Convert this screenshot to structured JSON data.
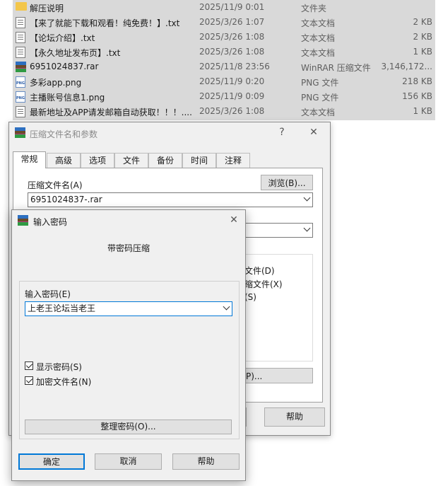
{
  "files": [
    {
      "icon": "folder-icon",
      "name": "解压说明",
      "date": "2025/11/9 0:01",
      "type": "文件夹",
      "size": ""
    },
    {
      "icon": "txt-file-icon",
      "name": "【来了就能下载和观看！纯免费！】.txt",
      "date": "2025/3/26 1:07",
      "type": "文本文档",
      "size": "2 KB"
    },
    {
      "icon": "txt-file-icon",
      "name": "【论坛介绍】.txt",
      "date": "2025/3/26 1:08",
      "type": "文本文档",
      "size": "2 KB"
    },
    {
      "icon": "txt-file-icon",
      "name": "【永久地址发布页】.txt",
      "date": "2025/3/26 1:08",
      "type": "文本文档",
      "size": "1 KB"
    },
    {
      "icon": "rar-file-icon",
      "name": "6951024837.rar",
      "date": "2025/11/8 23:56",
      "type": "WinRAR 压缩文件",
      "size": "3,146,172..."
    },
    {
      "icon": "png-file-icon",
      "name": "多彩app.png",
      "date": "2025/11/9 0:20",
      "type": "PNG 文件",
      "size": "218 KB"
    },
    {
      "icon": "png-file-icon",
      "name": "主播账号信息1.png",
      "date": "2025/11/9 0:09",
      "type": "PNG 文件",
      "size": "156 KB"
    },
    {
      "icon": "txt-file-icon",
      "name": "最新地址及APP请发邮箱自动获取！！！....",
      "date": "2025/3/26 1:08",
      "type": "文本文档",
      "size": "1 KB"
    }
  ],
  "archive_dialog": {
    "title": "压缩文件名和参数",
    "help_glyph": "?",
    "close_glyph": "✕",
    "tabs": [
      "常规",
      "高级",
      "选项",
      "文件",
      "备份",
      "时间",
      "注释"
    ],
    "archive_name_label": "压缩文件名(A)",
    "browse_button": "浏览(B)...",
    "archive_name_value": "6951024837-.rar",
    "partial_options": [
      "文件(D)",
      "缩文件(X)",
      "(S)"
    ],
    "partial_button": "P)...",
    "help_button": "帮助"
  },
  "password_dialog": {
    "title": "输入密码",
    "close_glyph": "✕",
    "heading": "带密码压缩",
    "enter_password_label": "输入密码(E)",
    "password_value": "上老王论坛当老王",
    "show_password_label": "显示密码(S)",
    "show_password_checked": true,
    "encrypt_names_label": "加密文件名(N)",
    "encrypt_names_checked": true,
    "organize_button": "整理密码(O)...",
    "ok_button": "确定",
    "cancel_button": "取消",
    "help_button": "帮助"
  }
}
